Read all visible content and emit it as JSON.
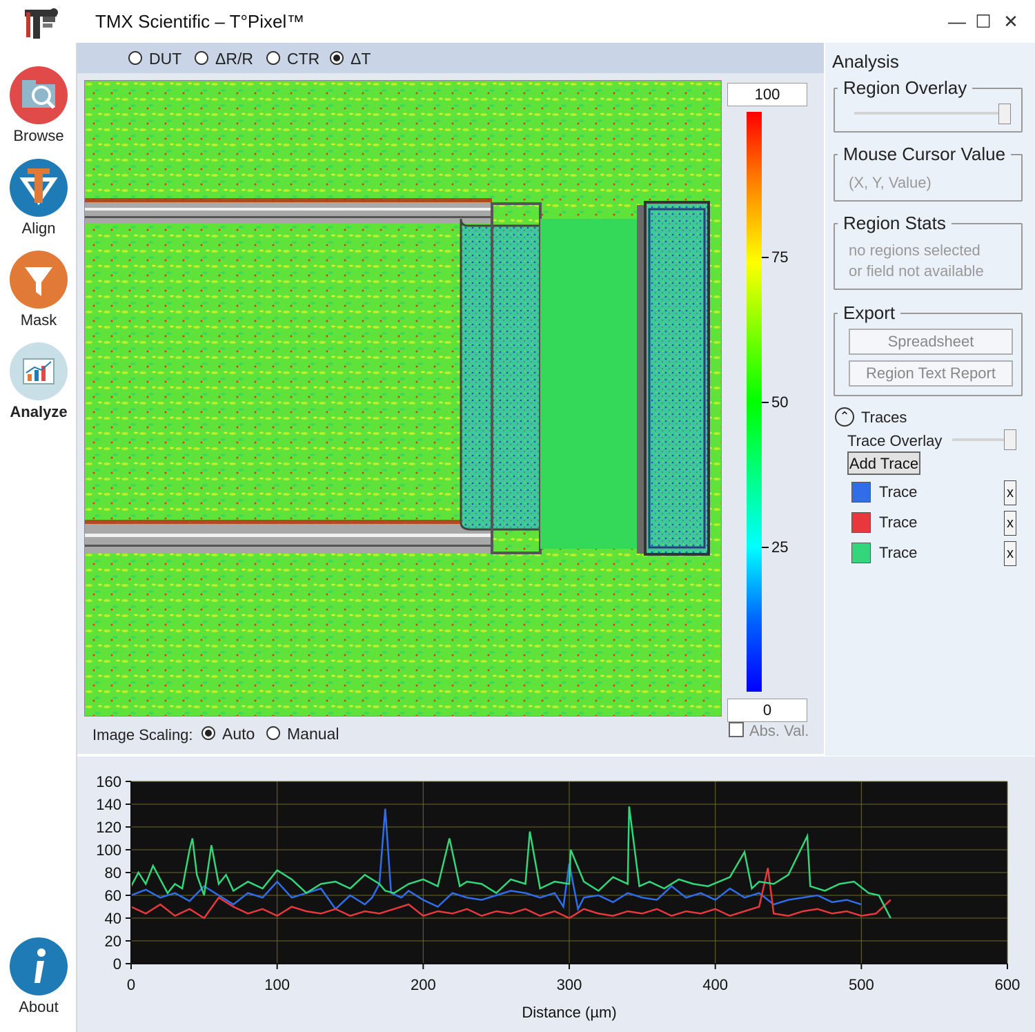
{
  "window": {
    "title": "TMX Scientific – T°Pixel™",
    "minimize": "—",
    "maximize": "☐",
    "close": "✕"
  },
  "nav": [
    {
      "label": "Browse",
      "color": "#e04a49"
    },
    {
      "label": "Align",
      "color": "#1f7bb5"
    },
    {
      "label": "Mask",
      "color": "#e07a36"
    },
    {
      "label": "Analyze",
      "color": "#c9dfe8"
    },
    {
      "label": "About",
      "color": "#1f7bb5"
    }
  ],
  "modes": [
    {
      "label": "DUT",
      "selected": false
    },
    {
      "label": "ΔR/R",
      "selected": false
    },
    {
      "label": "CTR",
      "selected": false
    },
    {
      "label": "ΔT",
      "selected": true
    }
  ],
  "colorbar": {
    "max": "100",
    "min": "0",
    "ticks": [
      "75",
      "50",
      "25"
    ],
    "abs_label": "Abs. Val.",
    "abs_checked": false
  },
  "scaling": {
    "label": "Image Scaling:",
    "options": [
      {
        "label": "Auto",
        "selected": true
      },
      {
        "label": "Manual",
        "selected": false
      }
    ]
  },
  "analysis": {
    "title": "Analysis",
    "region_overlay": "Region Overlay",
    "mouse_cursor": {
      "title": "Mouse Cursor Value",
      "value": "(X, Y, Value)"
    },
    "region_stats": {
      "title": "Region Stats",
      "line1": "no regions selected",
      "line2": "or field not available"
    },
    "export": {
      "title": "Export",
      "spreadsheet": "Spreadsheet",
      "report": "Region Text Report"
    },
    "traces": {
      "title": "Traces",
      "overlay_label": "Trace Overlay",
      "add_label": "Add Trace",
      "items": [
        {
          "label": "Trace",
          "color": "#2f6ee8",
          "remove": "x"
        },
        {
          "label": "Trace",
          "color": "#e8383d",
          "remove": "x"
        },
        {
          "label": "Trace",
          "color": "#33d67a",
          "remove": "x"
        }
      ]
    }
  },
  "chart_data": {
    "type": "line",
    "xlabel": "Distance (µm)",
    "ylabel": "",
    "xlim": [
      0,
      600
    ],
    "ylim": [
      0,
      160
    ],
    "xticks": [
      "0",
      "100",
      "200",
      "300",
      "400",
      "500",
      "600"
    ],
    "yticks": [
      "0",
      "20",
      "40",
      "60",
      "80",
      "100",
      "120",
      "140",
      "160"
    ],
    "grid": true,
    "series": [
      {
        "color": "#2f6ee8",
        "x": [
          0,
          10,
          20,
          30,
          40,
          50,
          60,
          70,
          80,
          90,
          100,
          110,
          120,
          130,
          140,
          150,
          160,
          165,
          170,
          174,
          178,
          185,
          190,
          200,
          210,
          220,
          230,
          240,
          250,
          260,
          270,
          280,
          290,
          296,
          300,
          306,
          310,
          320,
          330,
          340,
          350,
          360,
          370,
          380,
          390,
          400,
          410,
          420,
          430,
          440,
          450,
          460,
          470,
          480,
          490,
          500
        ],
        "y": [
          60,
          65,
          58,
          62,
          55,
          68,
          60,
          52,
          62,
          58,
          72,
          58,
          62,
          66,
          48,
          60,
          52,
          58,
          70,
          136,
          62,
          58,
          64,
          56,
          50,
          62,
          58,
          56,
          60,
          64,
          62,
          58,
          62,
          50,
          88,
          48,
          58,
          60,
          54,
          62,
          58,
          56,
          68,
          58,
          62,
          56,
          66,
          58,
          62,
          52,
          56,
          58,
          60,
          54,
          56,
          52
        ]
      },
      {
        "color": "#e8383d",
        "x": [
          0,
          10,
          20,
          30,
          40,
          50,
          60,
          70,
          80,
          90,
          100,
          110,
          120,
          130,
          140,
          150,
          160,
          170,
          180,
          190,
          200,
          210,
          220,
          230,
          240,
          250,
          260,
          270,
          280,
          290,
          300,
          310,
          320,
          330,
          340,
          350,
          360,
          370,
          380,
          390,
          400,
          410,
          420,
          430,
          436,
          440,
          450,
          460,
          470,
          480,
          490,
          500,
          510,
          520
        ],
        "y": [
          50,
          44,
          52,
          42,
          48,
          40,
          58,
          50,
          44,
          48,
          42,
          50,
          46,
          44,
          48,
          42,
          46,
          44,
          48,
          52,
          42,
          46,
          44,
          48,
          42,
          46,
          44,
          48,
          42,
          46,
          40,
          48,
          44,
          42,
          46,
          44,
          48,
          42,
          46,
          44,
          48,
          42,
          46,
          50,
          84,
          44,
          42,
          46,
          48,
          44,
          46,
          42,
          44,
          56
        ]
      },
      {
        "color": "#33d67a",
        "x": [
          0,
          5,
          10,
          15,
          20,
          25,
          30,
          35,
          40,
          42,
          45,
          50,
          55,
          60,
          65,
          70,
          80,
          90,
          100,
          110,
          120,
          130,
          140,
          150,
          160,
          170,
          174,
          180,
          190,
          200,
          210,
          218,
          225,
          230,
          240,
          250,
          260,
          270,
          273,
          280,
          290,
          300,
          301,
          310,
          320,
          330,
          340,
          341,
          348,
          355,
          365,
          375,
          385,
          395,
          410,
          420,
          425,
          430,
          440,
          450,
          463,
          465,
          475,
          485,
          495,
          505,
          512,
          520
        ],
        "y": [
          68,
          80,
          70,
          86,
          74,
          62,
          70,
          66,
          100,
          110,
          78,
          60,
          104,
          70,
          78,
          64,
          72,
          66,
          82,
          74,
          62,
          70,
          72,
          66,
          78,
          70,
          64,
          62,
          70,
          74,
          68,
          110,
          68,
          72,
          70,
          62,
          74,
          70,
          116,
          66,
          72,
          70,
          100,
          72,
          64,
          76,
          70,
          138,
          68,
          72,
          66,
          74,
          70,
          68,
          76,
          98,
          66,
          72,
          70,
          78,
          112,
          68,
          64,
          70,
          72,
          62,
          60,
          40
        ]
      }
    ]
  }
}
